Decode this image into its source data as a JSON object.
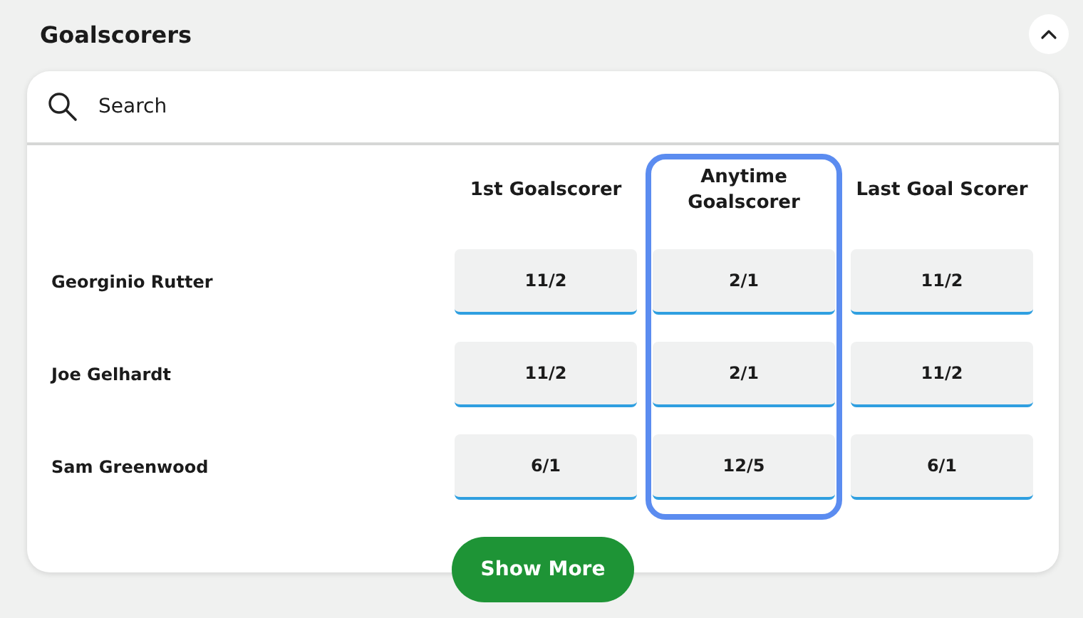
{
  "section": {
    "title": "Goalscorers",
    "expanded": true
  },
  "search": {
    "placeholder": "Search"
  },
  "columns": [
    {
      "label": "1st Goalscorer",
      "highlighted": false
    },
    {
      "label": "Anytime Goalscorer",
      "highlighted": true
    },
    {
      "label": "Last Goal Scorer",
      "highlighted": false
    }
  ],
  "rows": [
    {
      "name": "Georginio Rutter",
      "odds": [
        "11/2",
        "2/1",
        "11/2"
      ]
    },
    {
      "name": "Joe Gelhardt",
      "odds": [
        "11/2",
        "2/1",
        "11/2"
      ]
    },
    {
      "name": "Sam Greenwood",
      "odds": [
        "6/1",
        "12/5",
        "6/1"
      ]
    }
  ],
  "show_more": {
    "label": "Show More"
  }
}
